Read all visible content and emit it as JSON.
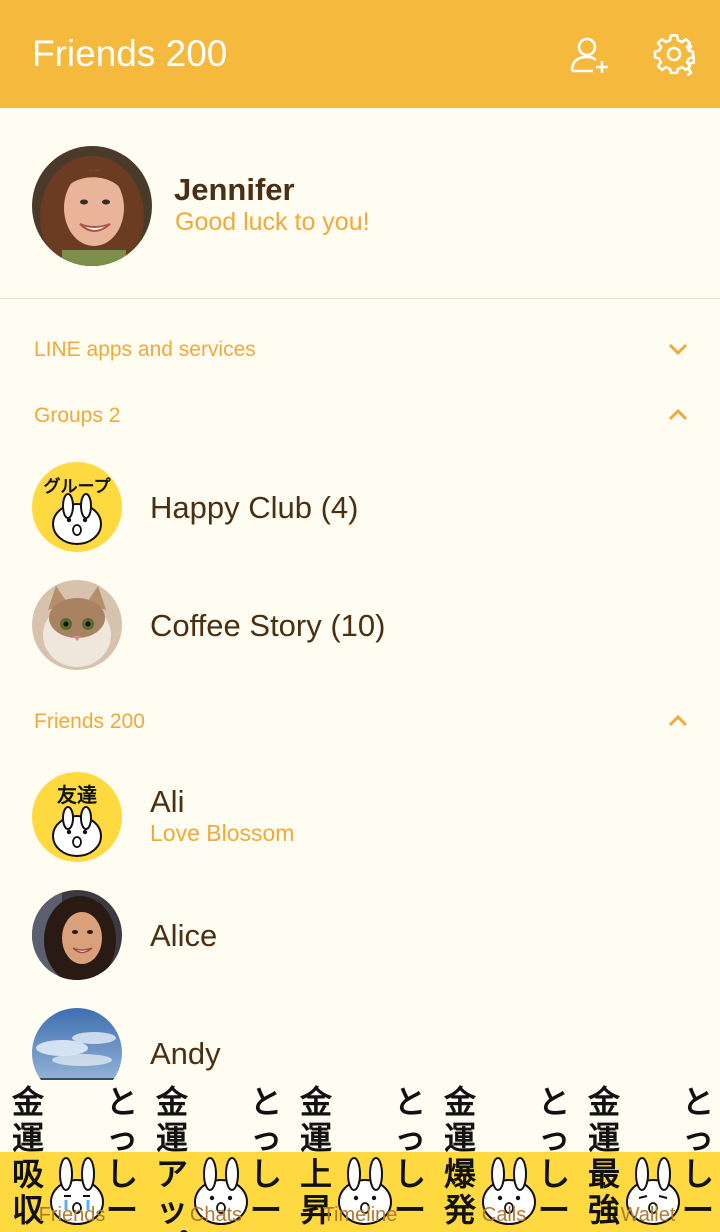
{
  "header": {
    "title": "Friends 200",
    "add_friend_icon": "add-person-icon",
    "settings_icon": "gear-icon"
  },
  "profile": {
    "name": "Jennifer",
    "status": "Good luck to you!"
  },
  "sections": {
    "apps": "LINE apps and services",
    "groups": "Groups 2",
    "friends": "Friends 200"
  },
  "groups": [
    {
      "name": "Happy Club (4)",
      "badge_text": "グループ"
    },
    {
      "name": "Coffee Story (10)"
    }
  ],
  "friends": [
    {
      "name": "Ali",
      "status": "Love Blossom",
      "badge_text": "友達"
    },
    {
      "name": "Alice"
    },
    {
      "name": "Andy"
    }
  ],
  "tabs": [
    {
      "label": "Friends",
      "text1": "金運吸収",
      "text2": "とっしー"
    },
    {
      "label": "Chats",
      "text1": "金運アップ",
      "text2": "とっしー"
    },
    {
      "label": "Timeline",
      "text1": "金運上昇",
      "text2": "とっしー"
    },
    {
      "label": "Calls",
      "text1": "金運爆発",
      "text2": "とっしー"
    },
    {
      "label": "Wallet",
      "text1": "金運最強",
      "text2": "とっしー"
    }
  ],
  "colors": {
    "header": "#f5b93e",
    "background": "#fffcf1",
    "accent": "#f0a93a",
    "text": "#4b2f12",
    "badge_yellow": "#ffd940"
  }
}
